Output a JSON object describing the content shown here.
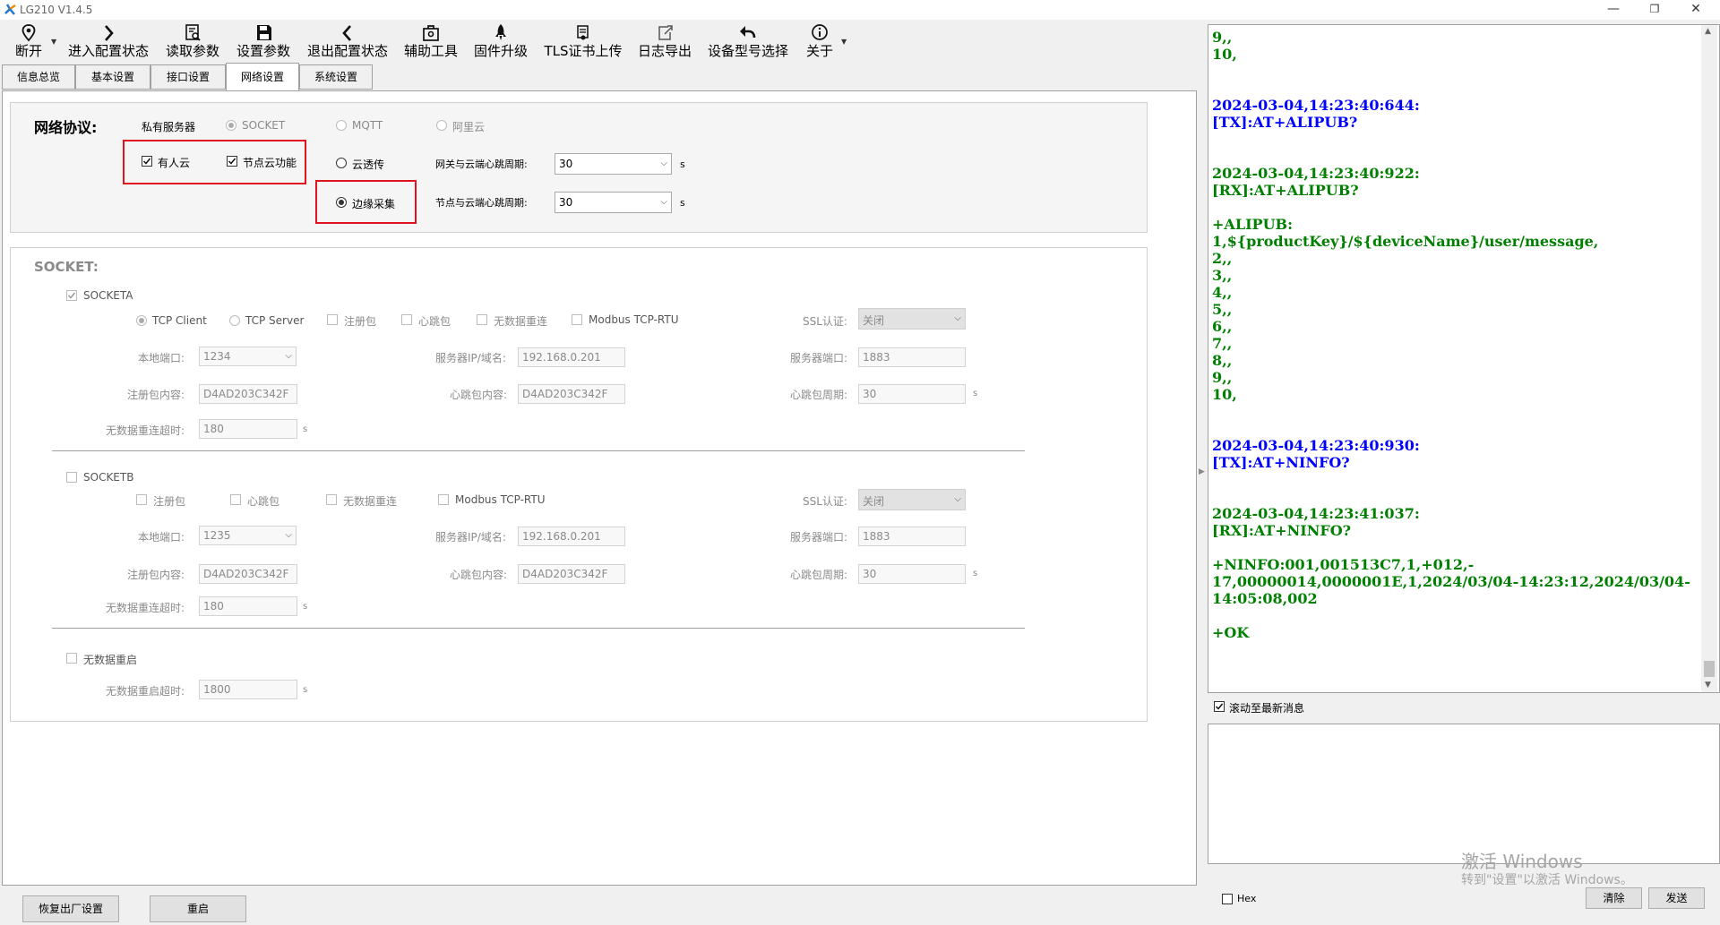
{
  "window": {
    "title": "LG210 V1.4.5",
    "controls": [
      "—",
      "❐",
      "✕"
    ]
  },
  "toolbar": {
    "items": [
      {
        "label": "断开",
        "icon": "location-pin-icon"
      },
      {
        "label": "进入配置状态",
        "icon": "chevron-right-icon"
      },
      {
        "label": "读取参数",
        "icon": "read-params-icon"
      },
      {
        "label": "设置参数",
        "icon": "save-icon"
      },
      {
        "label": "退出配置状态",
        "icon": "chevron-left-icon"
      },
      {
        "label": "辅助工具",
        "icon": "toolbox-icon"
      },
      {
        "label": "固件升级",
        "icon": "rocket-icon"
      },
      {
        "label": "TLS证书上传",
        "icon": "certificate-icon"
      },
      {
        "label": "日志导出",
        "icon": "export-icon"
      },
      {
        "label": "设备型号选择",
        "icon": "undo-icon"
      },
      {
        "label": "关于",
        "icon": "info-icon"
      }
    ]
  },
  "tabs": [
    {
      "label": "信息总览"
    },
    {
      "label": "基本设置"
    },
    {
      "label": "接口设置"
    },
    {
      "label": "网络设置",
      "active": true
    },
    {
      "label": "系统设置"
    }
  ],
  "network": {
    "protocol_label": "网络协议:",
    "private_server": "私有服务器",
    "socket": "SOCKET",
    "mqtt": "MQTT",
    "aliyun": "阿里云",
    "usr_cloud": "有人云",
    "node_cloud": "节点云功能",
    "cloud_pass": "云透传",
    "edge_collect": "边缘采集",
    "gw_heartbeat_label": "网关与云端心跳周期:",
    "gw_heartbeat_value": "30",
    "node_heartbeat_label": "节点与云端心跳周期:",
    "node_heartbeat_value": "30",
    "unit_s": "s"
  },
  "socket_section": {
    "title": "SOCKET:",
    "socketa": {
      "label": "SOCKETA",
      "tcp_client": "TCP Client",
      "tcp_server": "TCP Server",
      "reg_pkt": "注册包",
      "heart_pkt": "心跳包",
      "no_data_reconnect": "无数据重连",
      "modbus": "Modbus TCP-RTU",
      "ssl_label": "SSL认证:",
      "ssl_value": "关闭",
      "local_port_label": "本地端口:",
      "local_port": "1234",
      "server_ip_label": "服务器IP/域名:",
      "server_ip": "192.168.0.201",
      "server_port_label": "服务器端口:",
      "server_port": "1883",
      "reg_content_label": "注册包内容:",
      "reg_content": "D4AD203C342F",
      "heart_content_label": "心跳包内容:",
      "heart_content": "D4AD203C342F",
      "heart_period_label": "心跳包周期:",
      "heart_period": "30",
      "reconnect_timeout_label": "无数据重连超时:",
      "reconnect_timeout": "180"
    },
    "socketb": {
      "label": "SOCKETB",
      "reg_pkt": "注册包",
      "heart_pkt": "心跳包",
      "no_data_reconnect": "无数据重连",
      "modbus": "Modbus TCP-RTU",
      "ssl_label": "SSL认证:",
      "ssl_value": "关闭",
      "local_port_label": "本地端口:",
      "local_port": "1235",
      "server_ip_label": "服务器IP/域名:",
      "server_ip": "192.168.0.201",
      "server_port_label": "服务器端口:",
      "server_port": "1883",
      "reg_content_label": "注册包内容:",
      "reg_content": "D4AD203C342F",
      "heart_content_label": "心跳包内容:",
      "heart_content": "D4AD203C342F",
      "heart_period_label": "心跳包周期:",
      "heart_period": "30",
      "reconnect_timeout_label": "无数据重连超时:",
      "reconnect_timeout": "180"
    },
    "restart": {
      "label": "无数据重启",
      "timeout_label": "无数据重启超时:",
      "timeout": "1800"
    }
  },
  "bottom": {
    "factory_reset": "恢复出厂设置",
    "reboot": "重启"
  },
  "log": {
    "lines": [
      {
        "t": "9,,",
        "c": "green"
      },
      {
        "t": "10,",
        "c": "green"
      },
      {
        "t": "",
        "c": "green"
      },
      {
        "t": "",
        "c": "green"
      },
      {
        "t": "2024-03-04,14:23:40:644:",
        "c": "blue"
      },
      {
        "t": "[TX]:AT+ALIPUB?",
        "c": "blue"
      },
      {
        "t": "",
        "c": "blue"
      },
      {
        "t": "",
        "c": "blue"
      },
      {
        "t": "2024-03-04,14:23:40:922:",
        "c": "green"
      },
      {
        "t": "[RX]:AT+ALIPUB?",
        "c": "green"
      },
      {
        "t": "",
        "c": "green"
      },
      {
        "t": "+ALIPUB:",
        "c": "green"
      },
      {
        "t": "1,${productKey}/${deviceName}/user/message,",
        "c": "green"
      },
      {
        "t": "2,,",
        "c": "green"
      },
      {
        "t": "3,,",
        "c": "green"
      },
      {
        "t": "4,,",
        "c": "green"
      },
      {
        "t": "5,,",
        "c": "green"
      },
      {
        "t": "6,,",
        "c": "green"
      },
      {
        "t": "7,,",
        "c": "green"
      },
      {
        "t": "8,,",
        "c": "green"
      },
      {
        "t": "9,,",
        "c": "green"
      },
      {
        "t": "10,",
        "c": "green"
      },
      {
        "t": "",
        "c": "green"
      },
      {
        "t": "",
        "c": "green"
      },
      {
        "t": "2024-03-04,14:23:40:930:",
        "c": "blue"
      },
      {
        "t": "[TX]:AT+NINFO?",
        "c": "blue"
      },
      {
        "t": "",
        "c": "blue"
      },
      {
        "t": "",
        "c": "blue"
      },
      {
        "t": "2024-03-04,14:23:41:037:",
        "c": "green"
      },
      {
        "t": "[RX]:AT+NINFO?",
        "c": "green"
      },
      {
        "t": "",
        "c": "green"
      },
      {
        "t": "+NINFO:001,001513C7,1,+012,-",
        "c": "green"
      },
      {
        "t": "17,00000014,0000001E,1,2024/03/04-14:23:12,2024/03/04-",
        "c": "green"
      },
      {
        "t": "14:05:08,002",
        "c": "green"
      },
      {
        "t": "",
        "c": "green"
      },
      {
        "t": "+OK",
        "c": "green"
      }
    ],
    "scroll_latest": "滚动至最新消息",
    "hex_label": "Hex",
    "clear": "清除",
    "send": "发送"
  },
  "watermark": {
    "line1": "激活 Windows",
    "line2": "转到\"设置\"以激活 Windows。"
  }
}
